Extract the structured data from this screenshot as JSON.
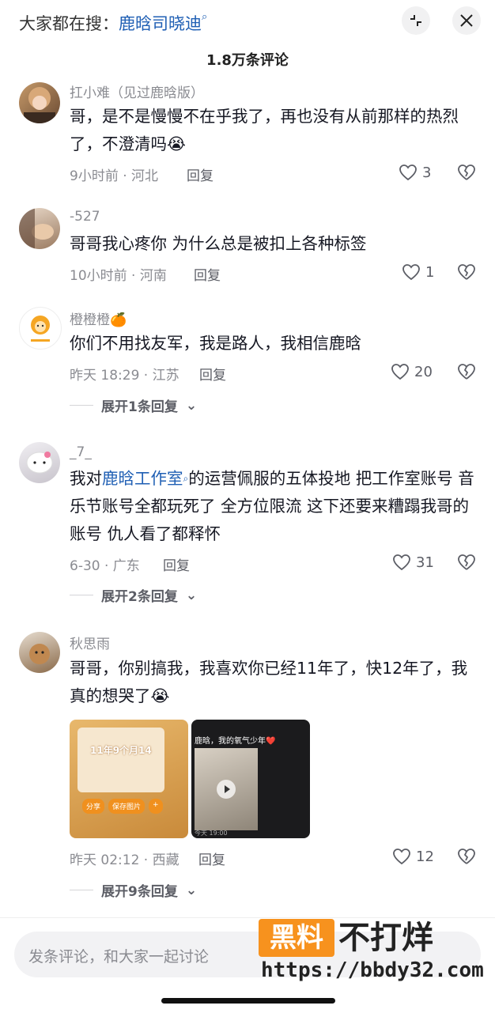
{
  "header": {
    "search_prefix": "大家都在搜：",
    "search_term": "鹿晗司晓迪"
  },
  "comment_count": "1.8万条评论",
  "comments": [
    {
      "username": "扛小难（见过鹿晗版）",
      "text": "哥，是不是慢慢不在乎我了，再也没有从前那样的热烈了，不澄清吗😭",
      "time_location": "9小时前 · 河北",
      "reply_label": "回复",
      "likes": "3"
    },
    {
      "username": "-527",
      "text": "哥哥我心疼你 为什么总是被扣上各种标签",
      "time_location": "10小时前 · 河南",
      "reply_label": "回复",
      "likes": "1"
    },
    {
      "username": "橙橙橙🍊",
      "text": "你们不用找友军，我是路人，我相信鹿晗",
      "time_location": "昨天 18:29 · 江苏",
      "reply_label": "回复",
      "likes": "20",
      "expand": "展开1条回复"
    },
    {
      "username": "_7_",
      "text_prefix": "我对",
      "text_link": "鹿晗工作室",
      "text_suffix": "的运营佩服的五体投地  把工作室账号  音乐节账号全都玩死了 全方位限流  这下还要来糟蹋我哥的账号  仇人看了都释怀",
      "time_location": "6-30 · 广东",
      "reply_label": "回复",
      "likes": "31",
      "expand": "展开2条回复"
    },
    {
      "username": "秋思雨",
      "text": "哥哥，你别搞我，我喜欢你已经11年了，快12年了，我真的想哭了😭",
      "time_location": "昨天 02:12 · 西藏",
      "reply_label": "回复",
      "likes": "12",
      "expand": "展开9条回复",
      "images": [
        {
          "caption": "11年9个月14",
          "buttons": [
            "分享",
            "保存图片"
          ]
        },
        {
          "caption": "鹿晗，我的氧气少年❤️",
          "footer": "今天 19:00"
        }
      ]
    }
  ],
  "input": {
    "placeholder": "发条评论，和大家一起讨论"
  },
  "watermark": {
    "badge": "黑料",
    "text": "不打烊",
    "url": "https://bbdy32.com"
  },
  "colors": {
    "link": "#1f5fb4",
    "muted": "#8a8b91",
    "watermark_orange": "#f7921e"
  }
}
